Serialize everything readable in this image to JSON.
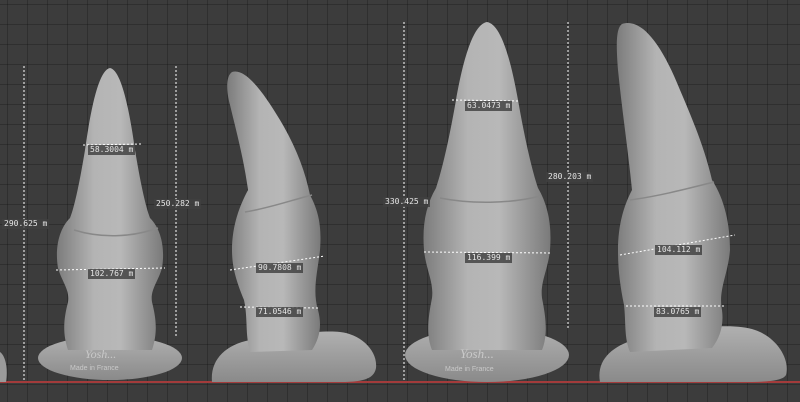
{
  "viewport": {
    "background": "#3c3c3c",
    "grid_color": "#2c2c2c",
    "x_axis_color": "#a33b3b",
    "model_color": "#a8a8a8"
  },
  "models": [
    {
      "name": "model-1",
      "brand_text": "Yosh...",
      "brand_subtext": "Made in France",
      "measurements": {
        "height": "290.625 m",
        "shaft_height": "250.282 m",
        "tip_circumference": "58.3004 m",
        "mid_circumference": "102.767 m"
      }
    },
    {
      "name": "model-2",
      "measurements": {
        "mid_circumference": "90.7808 m",
        "lower_circumference": "71.0546 m"
      }
    },
    {
      "name": "model-3",
      "brand_text": "Yosh...",
      "brand_subtext": "Made in France",
      "measurements": {
        "height": "330.425 m",
        "shaft_height": "280.203 m",
        "tip_circumference": "63.0473 m",
        "mid_circumference": "116.399 m"
      }
    },
    {
      "name": "model-4",
      "measurements": {
        "mid_circumference": "104.112 m",
        "lower_circumference": "83.0765 m"
      }
    }
  ]
}
